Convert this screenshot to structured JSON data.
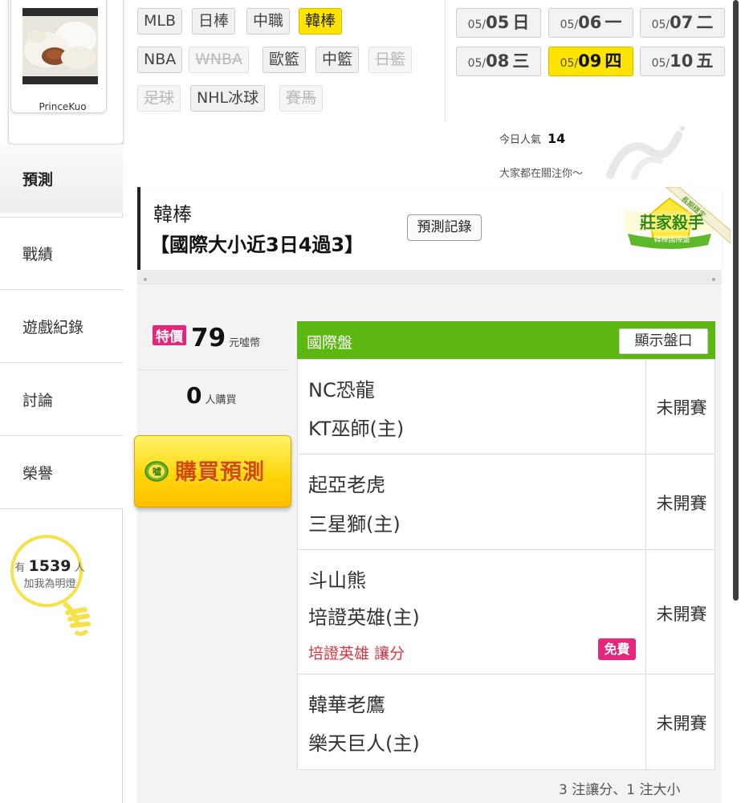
{
  "profile": {
    "username": "PrinceKuo"
  },
  "nav": {
    "items": [
      {
        "label": "預測",
        "active": true
      },
      {
        "label": "戰績"
      },
      {
        "label": "遊戲紀錄"
      },
      {
        "label": "討論"
      },
      {
        "label": "榮譽"
      }
    ]
  },
  "fans": {
    "prefix": "有",
    "count": "1539",
    "unit": "人",
    "text": "加我為明燈"
  },
  "leagues": [
    {
      "label": "MLB"
    },
    {
      "label": "日棒"
    },
    {
      "label": "中職"
    },
    {
      "label": "韓棒",
      "active": true
    },
    {
      "label": "NBA"
    },
    {
      "label": "WNBA",
      "disabled": true
    },
    {
      "label": "歐籃"
    },
    {
      "label": "中籃"
    },
    {
      "label": "日籃",
      "disabled": true
    },
    {
      "label": "足球",
      "disabled": true
    },
    {
      "label": "NHL冰球"
    },
    {
      "label": "賽馬",
      "disabled": true
    }
  ],
  "dates": [
    {
      "month": "05/",
      "day": "05",
      "weekday": "日"
    },
    {
      "month": "05/",
      "day": "06",
      "weekday": "一"
    },
    {
      "month": "05/",
      "day": "07",
      "weekday": "二"
    },
    {
      "month": "05/",
      "day": "08",
      "weekday": "三"
    },
    {
      "month": "05/",
      "day": "09",
      "weekday": "四",
      "active": true
    },
    {
      "month": "05/",
      "day": "10",
      "weekday": "五"
    }
  ],
  "popularity": {
    "label": "今日人氣",
    "value": "14",
    "sub": "大家都在關注你～"
  },
  "header": {
    "league": "韓棒",
    "subtitle": "【國際大小近3日4過3】",
    "record_button": "預測記錄",
    "badge_title": "莊家殺手",
    "badge_sub": "韓棒國際盤",
    "ribbon": "長期穩定"
  },
  "offer": {
    "badge": "特價",
    "price": "79",
    "currency": "元噓幣",
    "buyers": "0",
    "buyers_label": "人購買",
    "buy_button": "購買預測",
    "coin_glyph": "噓"
  },
  "table": {
    "title": "國際盤",
    "show_button": "顯示盤口",
    "games": [
      {
        "away": "NC恐龍",
        "home": "KT巫師(主)",
        "status": "未開賽"
      },
      {
        "away": "起亞老虎",
        "home": "三星獅(主)",
        "status": "未開賽"
      },
      {
        "away": "斗山熊",
        "home": "培證英雄(主)",
        "status": "未開賽",
        "pick": "培證英雄 讓分",
        "free": "免費"
      },
      {
        "away": "韓華老鷹",
        "home": "樂天巨人(主)",
        "status": "未開賽"
      }
    ]
  },
  "summary": "3 注讓分、1 注大小"
}
